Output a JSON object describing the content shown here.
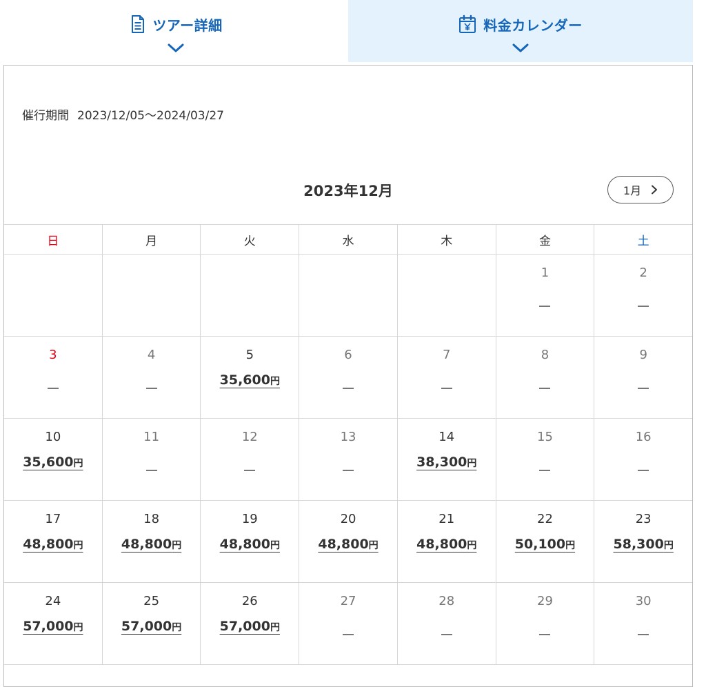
{
  "tabs": {
    "details": {
      "label": "ツアー詳細"
    },
    "calendar": {
      "label": "料金カレンダー"
    }
  },
  "period": {
    "label": "催行期間",
    "value": "2023/12/05〜2024/03/27"
  },
  "calendar": {
    "month_title": "2023年12月",
    "next_label": "1月",
    "weekdays": [
      "日",
      "月",
      "火",
      "水",
      "木",
      "金",
      "土"
    ],
    "price_unit": "円",
    "weeks": [
      [
        {
          "day": "",
          "price": ""
        },
        {
          "day": "",
          "price": ""
        },
        {
          "day": "",
          "price": ""
        },
        {
          "day": "",
          "price": ""
        },
        {
          "day": "",
          "price": ""
        },
        {
          "day": "1",
          "price": ""
        },
        {
          "day": "2",
          "price": ""
        }
      ],
      [
        {
          "day": "3",
          "price": ""
        },
        {
          "day": "4",
          "price": ""
        },
        {
          "day": "5",
          "price": "35,600"
        },
        {
          "day": "6",
          "price": ""
        },
        {
          "day": "7",
          "price": ""
        },
        {
          "day": "8",
          "price": ""
        },
        {
          "day": "9",
          "price": ""
        }
      ],
      [
        {
          "day": "10",
          "price": "35,600"
        },
        {
          "day": "11",
          "price": ""
        },
        {
          "day": "12",
          "price": ""
        },
        {
          "day": "13",
          "price": ""
        },
        {
          "day": "14",
          "price": "38,300"
        },
        {
          "day": "15",
          "price": ""
        },
        {
          "day": "16",
          "price": ""
        }
      ],
      [
        {
          "day": "17",
          "price": "48,800"
        },
        {
          "day": "18",
          "price": "48,800"
        },
        {
          "day": "19",
          "price": "48,800"
        },
        {
          "day": "20",
          "price": "48,800"
        },
        {
          "day": "21",
          "price": "48,800"
        },
        {
          "day": "22",
          "price": "50,100"
        },
        {
          "day": "23",
          "price": "58,300"
        }
      ],
      [
        {
          "day": "24",
          "price": "57,000"
        },
        {
          "day": "25",
          "price": "57,000"
        },
        {
          "day": "26",
          "price": "57,000"
        },
        {
          "day": "27",
          "price": ""
        },
        {
          "day": "28",
          "price": ""
        },
        {
          "day": "29",
          "price": ""
        },
        {
          "day": "30",
          "price": ""
        }
      ]
    ]
  },
  "colors": {
    "accent": "#1565b8",
    "sunday": "#e60012",
    "saturday": "#1565b8",
    "tab_active_bg": "#e3f2fc"
  },
  "icons": {
    "details": "document-icon",
    "calendar": "yen-calendar-icon",
    "chevron": "chevron-down-icon",
    "next": "chevron-right-icon"
  }
}
